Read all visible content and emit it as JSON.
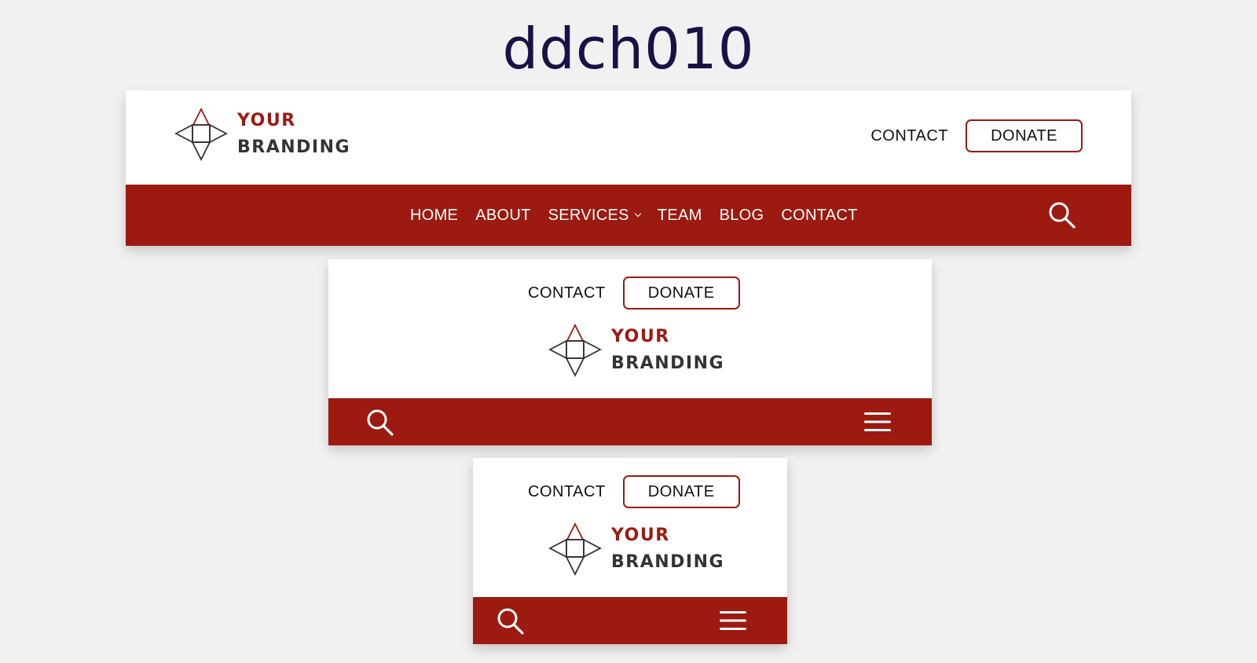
{
  "page": {
    "title": "ddch010"
  },
  "colors": {
    "brand": "#9c1a10",
    "nav_text": "#ffffff",
    "background": "#f1f1f1",
    "title": "#1a1147"
  },
  "branding": {
    "line1": "YOUR",
    "line2": "BRANDING",
    "logo_icon": "diamond-triangles-logo-icon"
  },
  "top_bar": {
    "contact_label": "CONTACT",
    "donate_label": "DONATE"
  },
  "nav": {
    "items": [
      {
        "label": "HOME"
      },
      {
        "label": "ABOUT"
      },
      {
        "label": "SERVICES",
        "has_dropdown": true
      },
      {
        "label": "TEAM"
      },
      {
        "label": "BLOG"
      },
      {
        "label": "CONTACT"
      }
    ],
    "search_icon": "search-icon",
    "menu_icon": "hamburger-icon"
  }
}
